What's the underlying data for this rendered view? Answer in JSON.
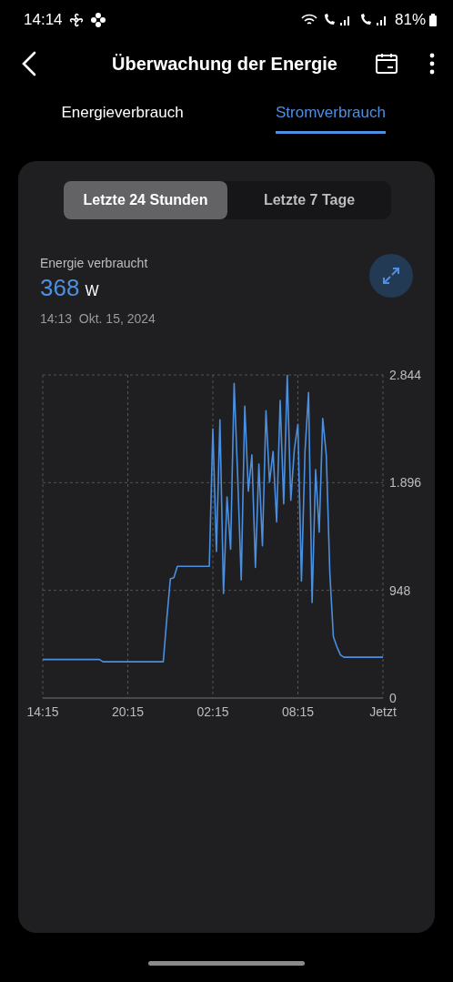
{
  "status_bar": {
    "time": "14:14",
    "battery": "81%"
  },
  "app_bar": {
    "title": "Überwachung der Energie"
  },
  "tabs": [
    {
      "label": "Energieverbrauch",
      "selected": false
    },
    {
      "label": "Stromverbrauch",
      "selected": true
    }
  ],
  "range_selector": [
    {
      "label": "Letzte 24 Stunden",
      "selected": true
    },
    {
      "label": "Letzte 7 Tage",
      "selected": false
    }
  ],
  "reading": {
    "label": "Energie verbraucht",
    "value": "368",
    "unit": "W",
    "timestamp": "14:13  Okt. 15, 2024"
  },
  "chart_data": {
    "type": "line",
    "grid": true,
    "categories": [
      "14:15",
      null,
      null,
      null,
      null,
      null,
      null,
      null,
      null,
      null,
      null,
      null,
      null,
      null,
      null,
      null,
      null,
      null,
      null,
      null,
      null,
      null,
      null,
      null,
      "20:15",
      null,
      null,
      null,
      null,
      null,
      null,
      null,
      null,
      null,
      null,
      null,
      null,
      null,
      null,
      null,
      null,
      null,
      null,
      null,
      null,
      null,
      null,
      null,
      "02:15",
      null,
      null,
      null,
      null,
      null,
      null,
      null,
      null,
      null,
      null,
      null,
      null,
      null,
      null,
      null,
      null,
      null,
      null,
      null,
      null,
      null,
      null,
      null,
      "08:15",
      null,
      null,
      null,
      null,
      null,
      null,
      null,
      null,
      null,
      null,
      null,
      null,
      null,
      null,
      null,
      null,
      null,
      null,
      null,
      null,
      null,
      null,
      null,
      "Jetzt"
    ],
    "series": [
      {
        "color": "#4a8fe0",
        "values": [
          340,
          340,
          340,
          340,
          340,
          340,
          340,
          340,
          340,
          340,
          340,
          340,
          340,
          340,
          340,
          340,
          340,
          320,
          320,
          320,
          320,
          320,
          320,
          320,
          320,
          320,
          320,
          320,
          320,
          320,
          320,
          320,
          320,
          320,
          320,
          700,
          1050,
          1060,
          1160,
          1160,
          1160,
          1160,
          1160,
          1160,
          1160,
          1160,
          1160,
          1160,
          2370,
          1290,
          2450,
          920,
          1770,
          1310,
          2770,
          1950,
          1040,
          2570,
          1820,
          2140,
          1150,
          2060,
          1340,
          2530,
          1900,
          2170,
          1550,
          2620,
          1710,
          2840,
          1740,
          2190,
          2410,
          1030,
          2170,
          2690,
          840,
          2010,
          1460,
          2460,
          2140,
          1100,
          540,
          450,
          380,
          360,
          360,
          360,
          360,
          360,
          360,
          360,
          360,
          360,
          360,
          360,
          360
        ]
      }
    ],
    "ylim": [
      0,
      2844
    ],
    "yticks": [
      {
        "value": 0,
        "label": "0"
      },
      {
        "value": 948,
        "label": "948"
      },
      {
        "value": 1896,
        "label": "1.896"
      },
      {
        "value": 2844,
        "label": "2.844"
      }
    ]
  }
}
